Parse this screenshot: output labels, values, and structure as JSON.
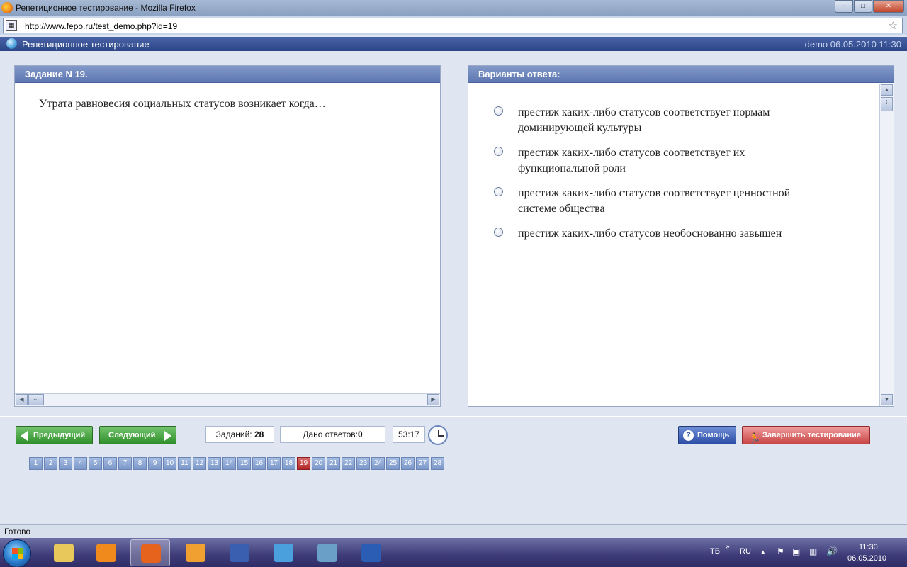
{
  "window": {
    "title": "Репетиционное тестирование - Mozilla Firefox",
    "controls": {
      "minimize": "–",
      "maximize": "□",
      "close": "✕"
    }
  },
  "browser": {
    "url": "http://www.fepo.ru/test_demo.php?id=19",
    "bookmark_icon": "star-icon",
    "status": "Готово"
  },
  "app": {
    "title": "Репетиционное тестирование",
    "session": "demo 06.05.2010 11:30"
  },
  "question": {
    "header": "Задание N 19.",
    "text": "Утрата равновесия социальных статусов возникает когда…"
  },
  "answers": {
    "header": "Варианты ответа:",
    "options": [
      {
        "text": "престиж каких-либо статусов соответствует нормам доминирующей культуры",
        "selected": false
      },
      {
        "text": "престиж каких-либо статусов соответствует их функциональной роли",
        "selected": false
      },
      {
        "text": "престиж каких-либо статусов соответствует ценностной системе общества",
        "selected": false
      },
      {
        "text": "престиж каких-либо статусов необоснованно завышен",
        "selected": false
      }
    ]
  },
  "controls": {
    "prev_label": "Предыдущий",
    "next_label": "Следующий",
    "tasks_label": "Заданий:",
    "tasks_count": "28",
    "answered_label": "Дано ответов:",
    "answered_count": "0",
    "timer": "53:17",
    "help_label": "Помощь",
    "finish_label": "Завершить тестирование"
  },
  "pager": {
    "pages": [
      "1",
      "2",
      "3",
      "4",
      "5",
      "6",
      "7",
      "8",
      "9",
      "10",
      "11",
      "12",
      "13",
      "14",
      "15",
      "16",
      "17",
      "18",
      "19",
      "20",
      "21",
      "22",
      "23",
      "24",
      "25",
      "26",
      "27",
      "28"
    ],
    "current": "19"
  },
  "taskbar": {
    "apps": [
      {
        "name": "explorer",
        "icon": "folder-icon",
        "color": "#e8c85a",
        "active": false
      },
      {
        "name": "vlc",
        "icon": "vlc-cone-icon",
        "color": "#f08a1c",
        "active": false
      },
      {
        "name": "firefox",
        "icon": "firefox-icon",
        "color": "#e5631c",
        "active": true
      },
      {
        "name": "media-player",
        "icon": "media-player-icon",
        "color": "#f0a030",
        "active": false
      },
      {
        "name": "save",
        "icon": "floppy-icon",
        "color": "#3b5fb0",
        "active": false
      },
      {
        "name": "itunes",
        "icon": "itunes-icon",
        "color": "#4aa0dc",
        "active": false
      },
      {
        "name": "picture-viewer",
        "icon": "picture-icon",
        "color": "#6aa0c8",
        "active": false
      },
      {
        "name": "word",
        "icon": "word-icon",
        "color": "#2b5db4",
        "active": false
      }
    ],
    "tray": {
      "lang1": "ТВ",
      "lang2": "RU",
      "time": "11:30",
      "date": "06.05.2010"
    }
  },
  "colors": {
    "header_blue": "#2c4586",
    "green_button": "#2f8f2b",
    "red_button": "#c94545",
    "current_page": "#b32828"
  }
}
